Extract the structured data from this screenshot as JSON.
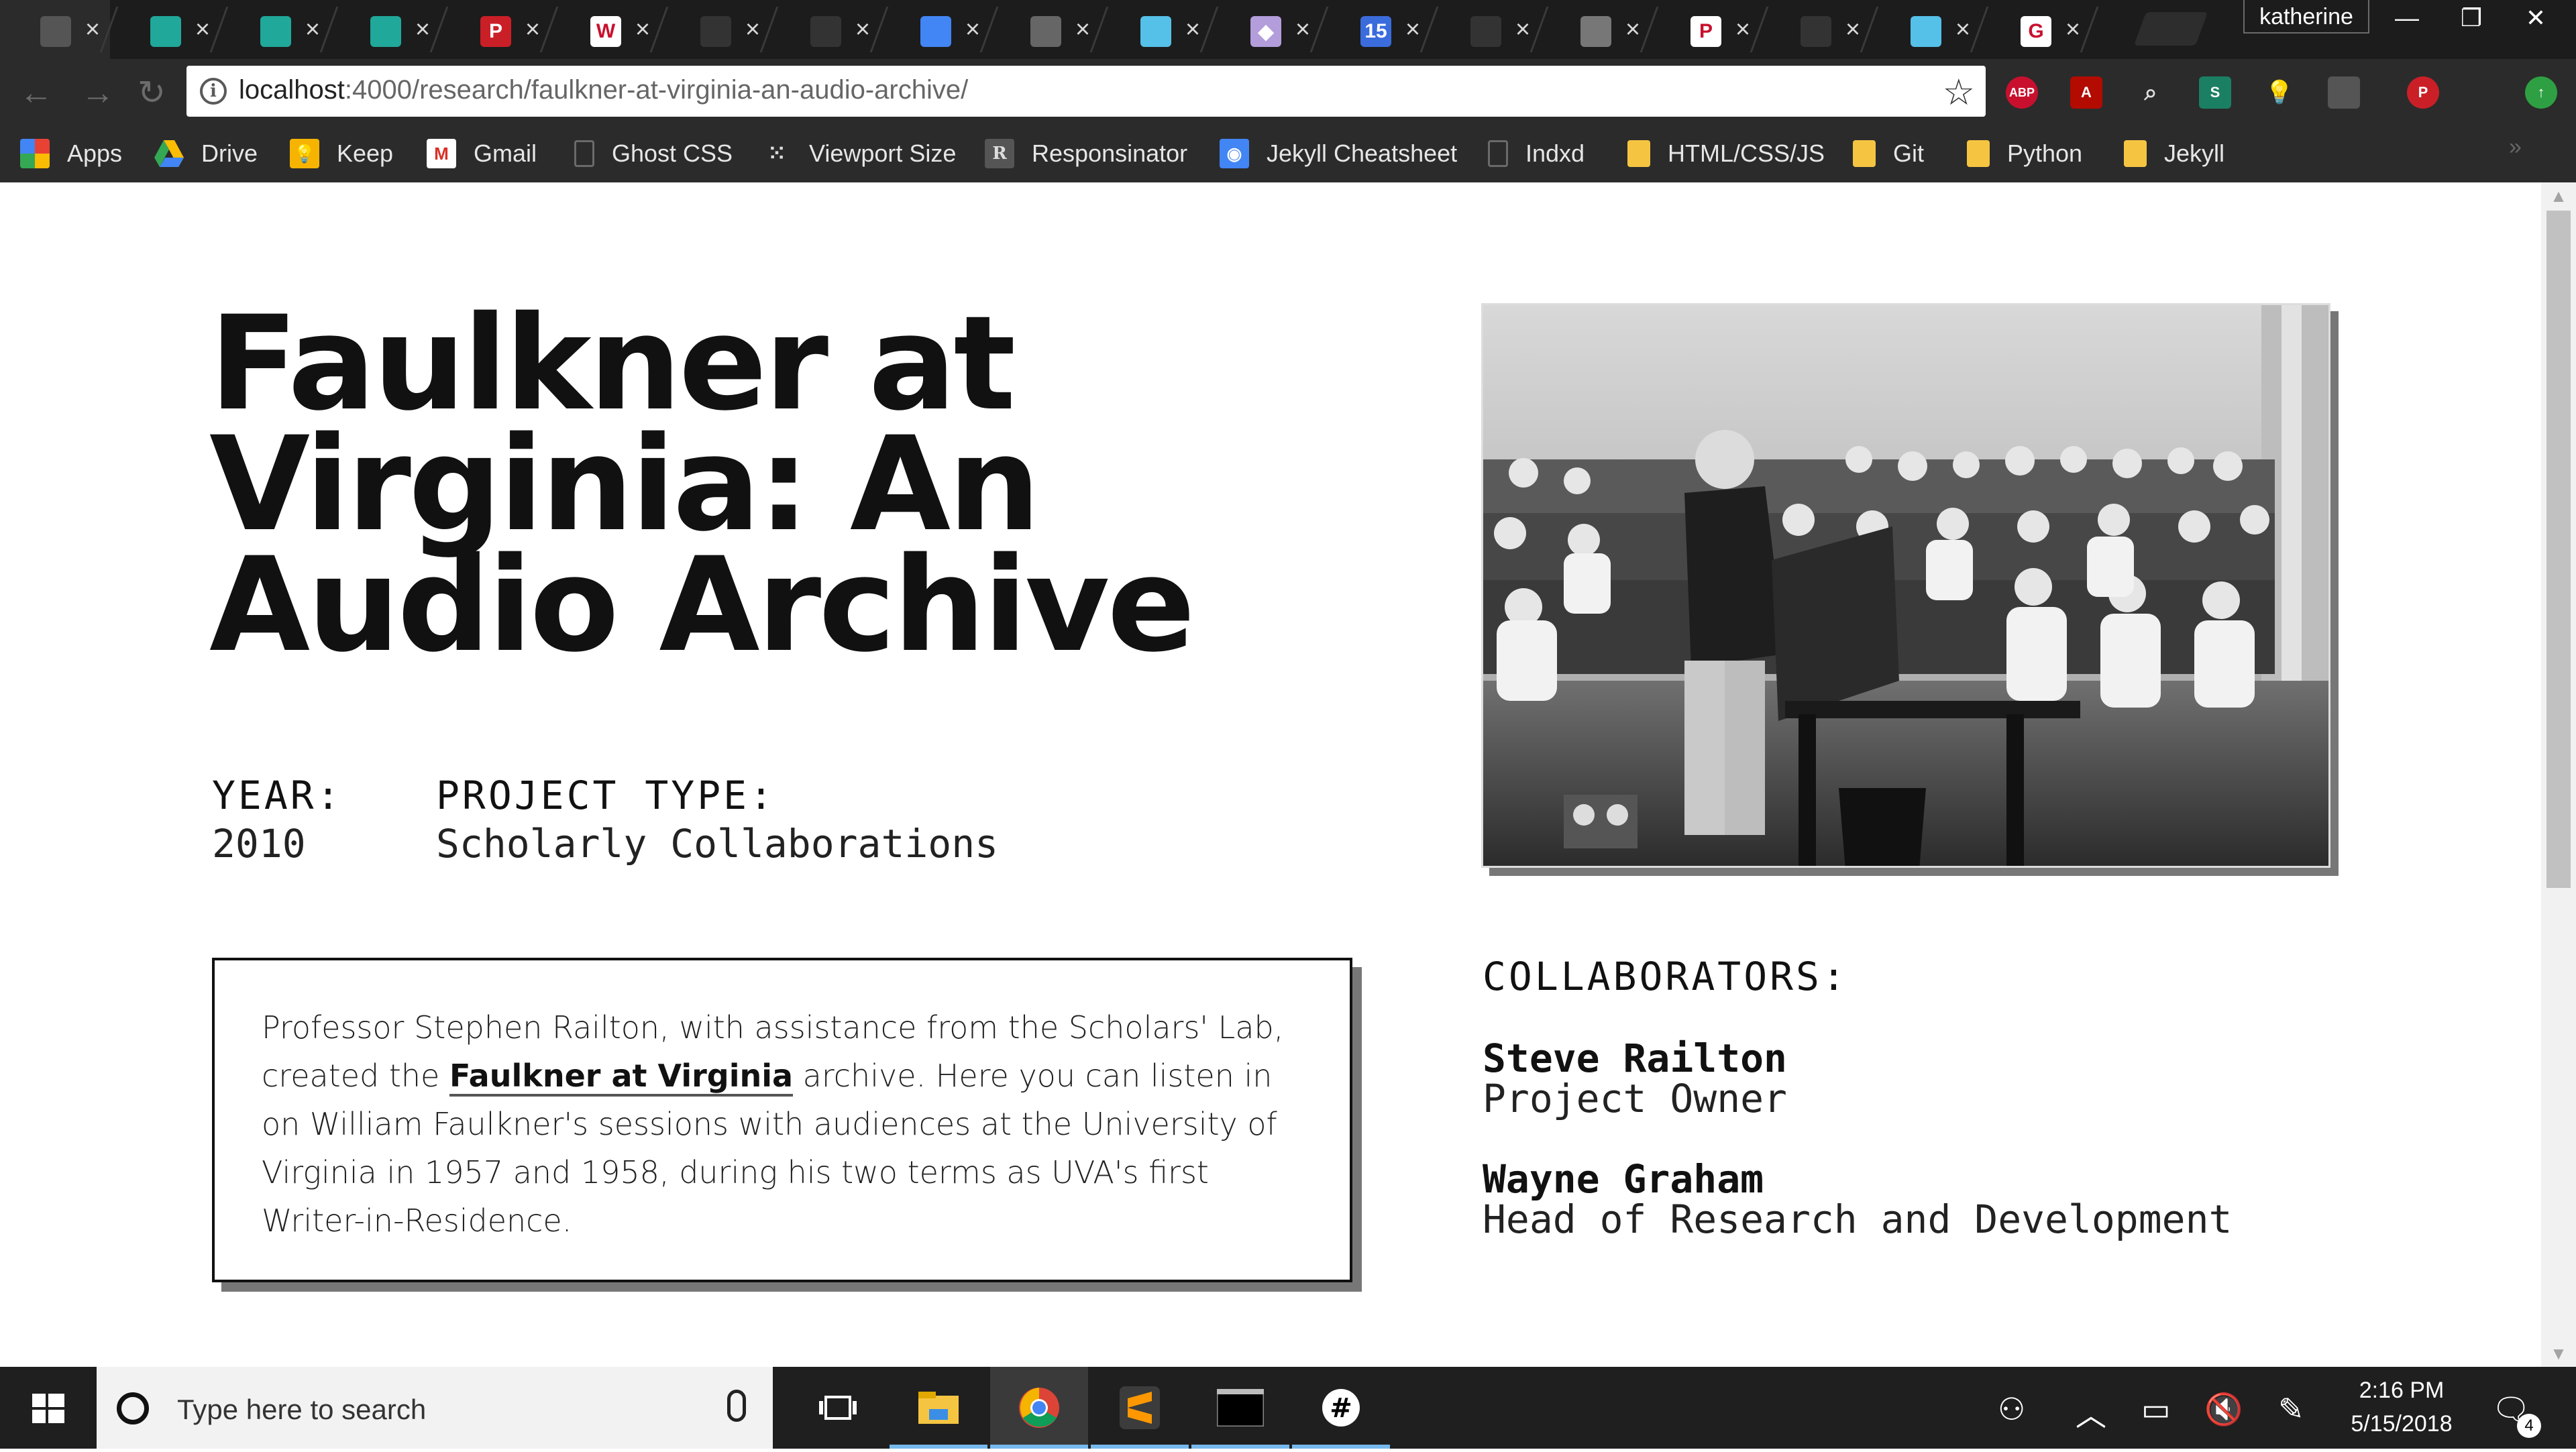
{
  "browser": {
    "tab_favicon_colors": [
      "#555555",
      "#20a89a",
      "#20a89a",
      "#20a89a",
      "#cb1f27",
      "#ffffff",
      "#333333",
      "#333333",
      "#4285f4",
      "#666666",
      "#55c0e8",
      "#b39ddb",
      "#3b6cdc",
      "#333333",
      "#777777",
      "#ffffff",
      "#333333",
      "#55c0e8",
      "#ffffff"
    ],
    "tab_favicon_glyphs": [
      "",
      "",
      "",
      "",
      "P",
      "W",
      "",
      "",
      "",
      "",
      "",
      "◆",
      "15",
      "",
      "",
      "P",
      "",
      "",
      "G"
    ],
    "profile_name": "katherine",
    "url_host": "localhost",
    "url_path": ":4000/research/faulkner-at-virginia-an-audio-archive/",
    "extensions": [
      "ABP",
      "Acrobat",
      "Search",
      "S",
      "Bulb",
      "Ext",
      "Pinterest",
      "Update"
    ]
  },
  "bookmarks": [
    {
      "label": "Apps",
      "icon": "apps-grid-icon"
    },
    {
      "label": "Drive",
      "icon": "drive-icon"
    },
    {
      "label": "Keep",
      "icon": "keep-icon"
    },
    {
      "label": "Gmail",
      "icon": "gmail-icon"
    },
    {
      "label": "Ghost CSS",
      "icon": "page-icon"
    },
    {
      "label": "Viewport Size",
      "icon": "viewport-icon"
    },
    {
      "label": "Responsinator",
      "icon": "r-icon"
    },
    {
      "label": "Jekyll Cheatsheet",
      "icon": "jekyll-icon"
    },
    {
      "label": "Indxd",
      "icon": "page-icon"
    },
    {
      "label": "HTML/CSS/JS",
      "icon": "folder-icon"
    },
    {
      "label": "Git",
      "icon": "folder-icon"
    },
    {
      "label": "Python",
      "icon": "folder-icon"
    },
    {
      "label": "Jekyll",
      "icon": "folder-icon"
    }
  ],
  "page": {
    "title": "Faulkner at Virginia: An Audio Archive",
    "year_label": "YEAR:",
    "year_value": "2010",
    "type_label": "PROJECT TYPE:",
    "type_value": "Scholarly Collaborations",
    "desc_before": "Professor Stephen Railton, with assistance from the Scholars' Lab, created the ",
    "desc_link": "Faulkner at Virginia",
    "desc_after": " archive. Here you can listen in on William Faulkner's sessions with audiences at the University of Virginia in 1957 and 1958, during his two terms as UVA's first Writer-in-Residence.",
    "collaborators_label": "COLLABORATORS:",
    "collaborators": [
      {
        "name": "Steve Railton",
        "role": "Project Owner"
      },
      {
        "name": "Wayne Graham",
        "role": "Head of Research and Development"
      }
    ]
  },
  "taskbar": {
    "search_placeholder": "Type here to search",
    "time": "2:16 PM",
    "date": "5/15/2018",
    "notification_count": "4"
  }
}
